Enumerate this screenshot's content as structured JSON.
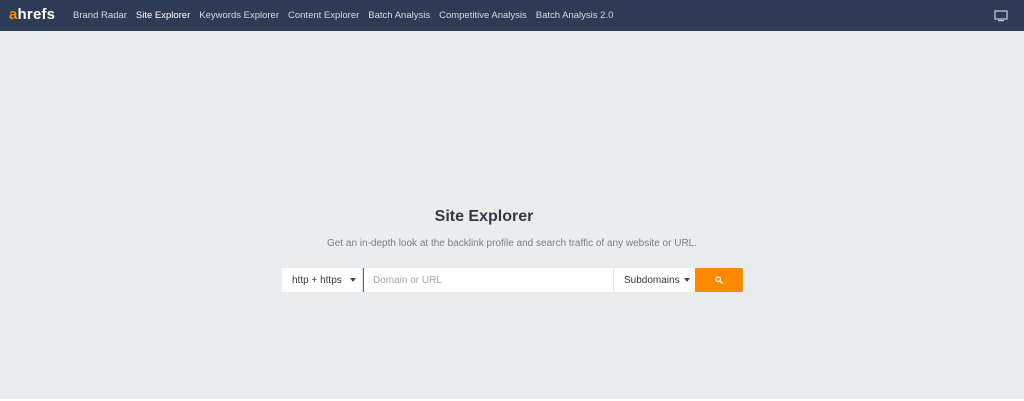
{
  "header": {
    "logo": {
      "accent": "a",
      "rest": "hrefs"
    },
    "nav": [
      {
        "label": "Brand Radar"
      },
      {
        "label": "Site Explorer",
        "active": true
      },
      {
        "label": "Keywords Explorer"
      },
      {
        "label": "Content Explorer"
      },
      {
        "label": "Batch Analysis"
      },
      {
        "label": "Competitive Analysis"
      },
      {
        "label": "Batch Analysis 2.0"
      }
    ],
    "right_icon": "monitor-icon"
  },
  "main": {
    "title": "Site Explorer",
    "subtitle": "Get an in-depth look at the backlink profile and search traffic of any website or URL.",
    "search": {
      "protocol": "http + https",
      "placeholder": "Domain or URL",
      "value": "",
      "scope": "Subdomains",
      "button_icon": "search-icon"
    }
  },
  "colors": {
    "header_bg": "#2e3b55",
    "accent": "#ff8a00",
    "page_bg": "#ebecee"
  }
}
